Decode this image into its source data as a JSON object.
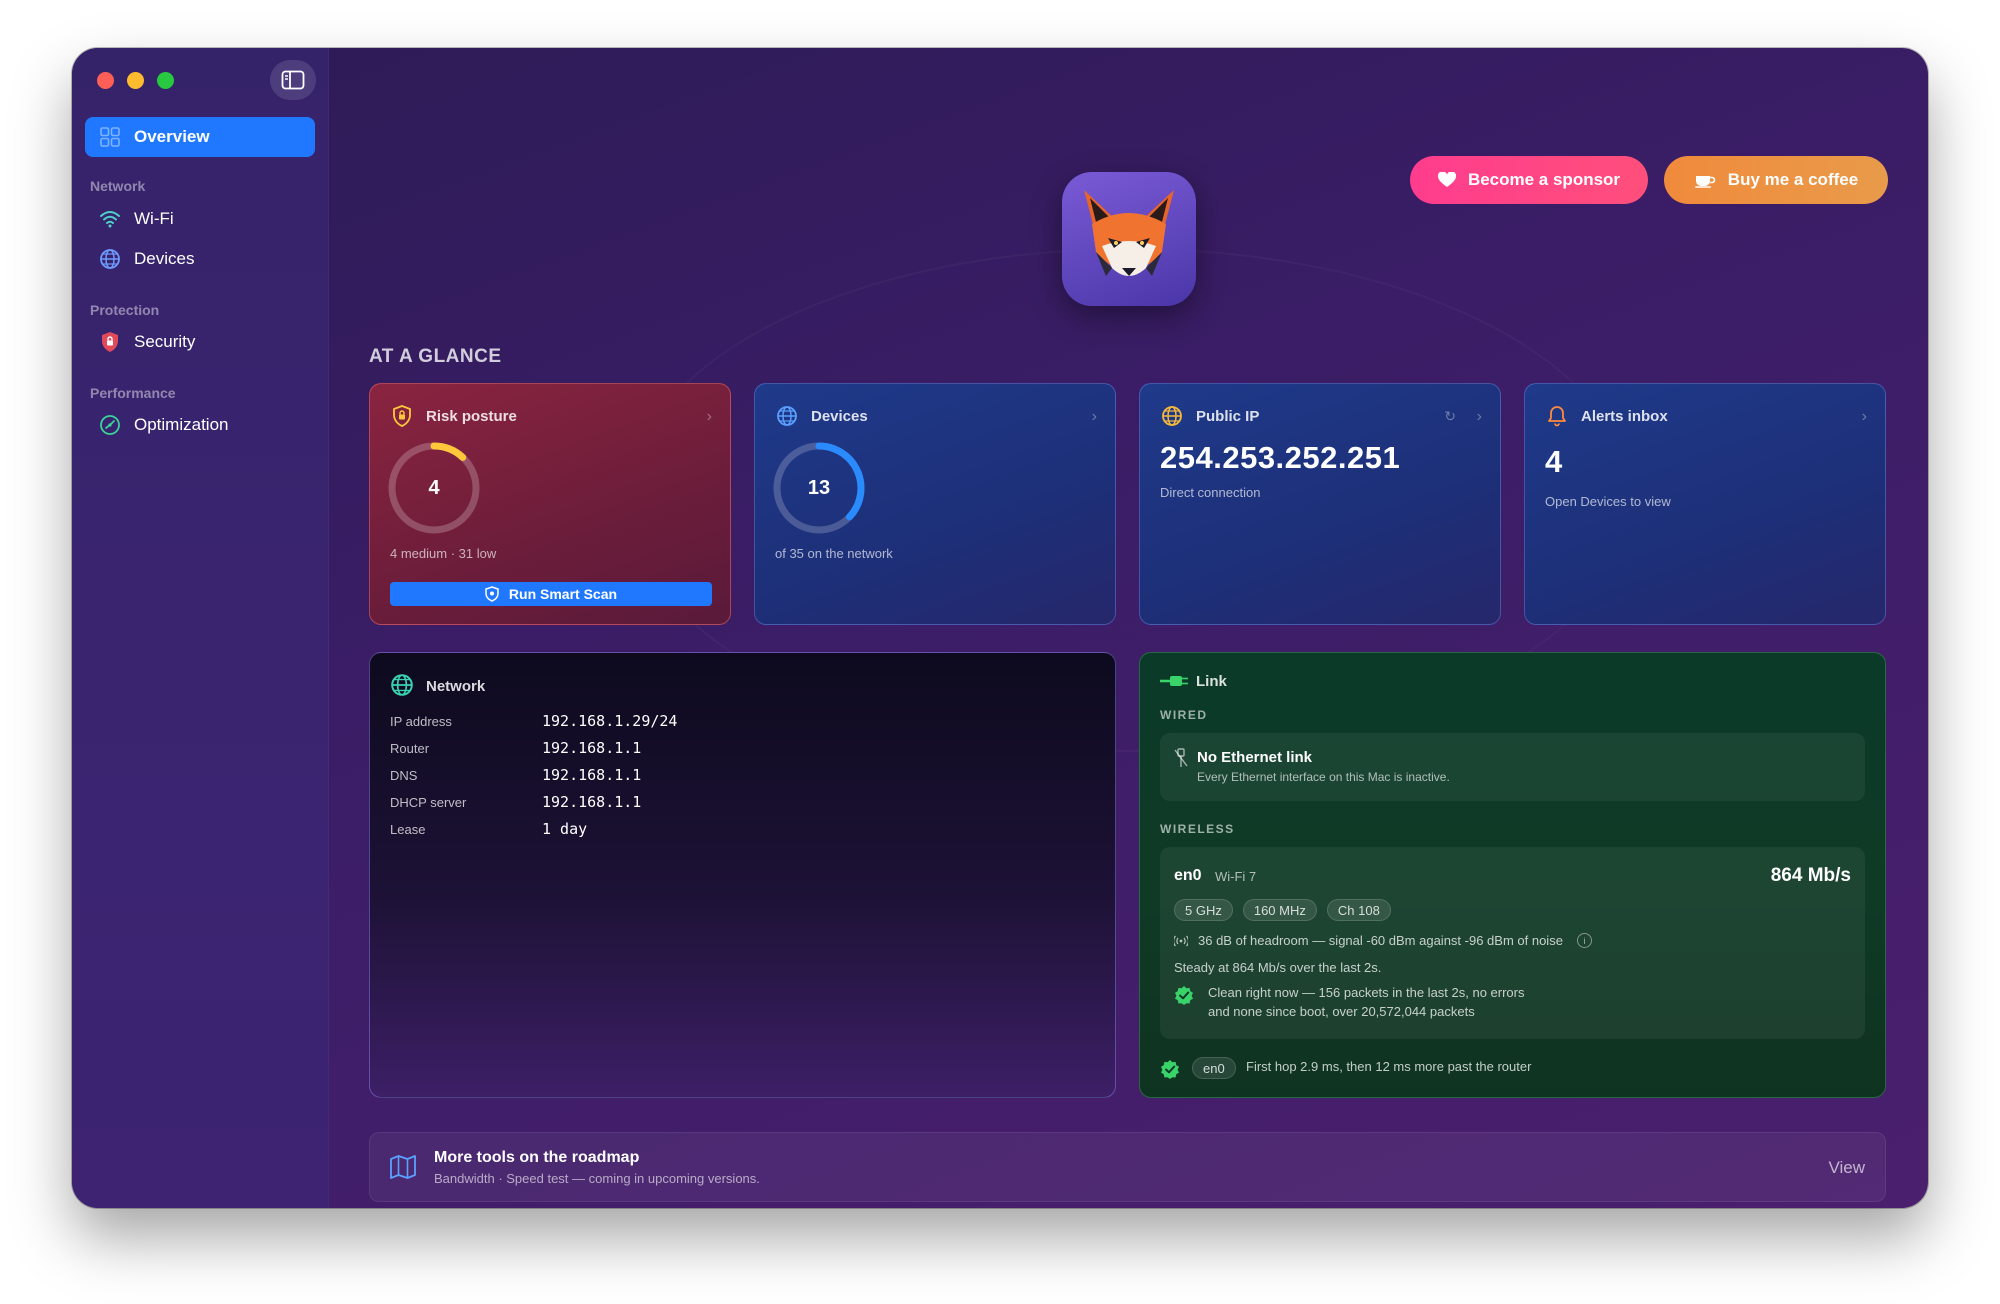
{
  "sidebar": {
    "items": {
      "overview": "Overview",
      "wifi": "Wi-Fi",
      "devices": "Devices",
      "security": "Security",
      "optimization": "Optimization"
    },
    "sections": {
      "network": "Network",
      "protection": "Protection",
      "performance": "Performance"
    }
  },
  "header": {
    "sponsor_label": "Become a sponsor",
    "coffee_label": "Buy me a coffee"
  },
  "glance": {
    "title": "AT A GLANCE",
    "risk": {
      "title": "Risk posture",
      "value": "4",
      "summary": "4 medium · 31 low",
      "ring_fraction": 0.12,
      "scan_label": "Run Smart Scan"
    },
    "devices": {
      "title": "Devices",
      "value": "13",
      "summary": "of 35 on the network",
      "ring_fraction": 0.37
    },
    "public_ip": {
      "title": "Public IP",
      "value": "254.253.252.251",
      "summary": "Direct connection"
    },
    "alerts": {
      "title": "Alerts inbox",
      "value": "4",
      "summary": "Open Devices to view"
    }
  },
  "network": {
    "title": "Network",
    "rows": [
      {
        "k": "IP address",
        "v": "192.168.1.29/24"
      },
      {
        "k": "Router",
        "v": "192.168.1.1"
      },
      {
        "k": "DNS",
        "v": "192.168.1.1"
      },
      {
        "k": "DHCP server",
        "v": "192.168.1.1"
      },
      {
        "k": "Lease",
        "v": "1 day"
      }
    ]
  },
  "link": {
    "title": "Link",
    "wired_label": "WIRED",
    "wired_title": "No Ethernet link",
    "wired_desc": "Every Ethernet interface on this Mac is inactive.",
    "wireless_label": "WIRELESS",
    "iface": "en0",
    "standard": "Wi-Fi 7",
    "speed": "864 Mb/s",
    "chips": [
      "5 GHz",
      "160 MHz",
      "Ch 108"
    ],
    "signal": "36 dB of headroom — signal -60 dBm against -96 dBm of noise",
    "steady": "Steady at 864 Mb/s over the last 2s.",
    "clean_line1": "Clean right now — 156 packets in the last 2s, no errors",
    "clean_line2": "and none since boot, over 20,572,044 packets",
    "hop_iface": "en0",
    "hop": "First hop 2.9 ms, then 12 ms more past the router"
  },
  "roadmap": {
    "title": "More tools on the roadmap",
    "desc": "Bandwidth · Speed test — coming in upcoming versions.",
    "view": "View"
  },
  "colors": {
    "accent": "#1f78ff",
    "sponsor": "#ff3c8e",
    "coffee": "#f08a3c",
    "risk_ring": "#ffc83a",
    "device_ring": "#2a8bff",
    "ok_green": "#3ad36a"
  }
}
